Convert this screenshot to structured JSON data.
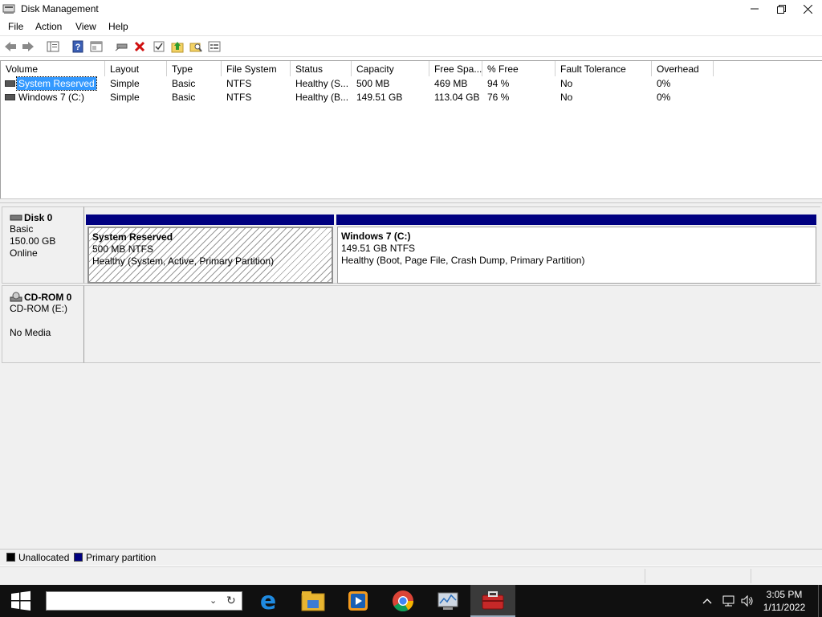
{
  "window": {
    "title": "Disk Management"
  },
  "menu": [
    "File",
    "Action",
    "View",
    "Help"
  ],
  "toolbar": {
    "icons": [
      "back-icon",
      "forward-icon",
      "console-tree-icon",
      "help-icon",
      "properties-icon",
      "connect-drive-icon",
      "delete-icon",
      "check-icon",
      "folder-up-icon",
      "folder-search-icon",
      "list-view-icon"
    ]
  },
  "volumes": {
    "columns": [
      "Volume",
      "Layout",
      "Type",
      "File System",
      "Status",
      "Capacity",
      "Free Spa...",
      "% Free",
      "Fault Tolerance",
      "Overhead"
    ],
    "rows": [
      {
        "volume": "System Reserved",
        "layout": "Simple",
        "type": "Basic",
        "fs": "NTFS",
        "status": "Healthy (S...",
        "capacity": "500 MB",
        "free": "469 MB",
        "pct": "94 %",
        "fault": "No",
        "overhead": "0%"
      },
      {
        "volume": "Windows 7 (C:)",
        "layout": "Simple",
        "type": "Basic",
        "fs": "NTFS",
        "status": "Healthy (B...",
        "capacity": "149.51 GB",
        "free": "113.04 GB",
        "pct": "76 %",
        "fault": "No",
        "overhead": "0%"
      }
    ]
  },
  "disks": [
    {
      "name": "Disk 0",
      "type": "Basic",
      "size": "150.00 GB",
      "state": "Online",
      "partitions": [
        {
          "name": "System Reserved",
          "size": "500 MB NTFS",
          "status": "Healthy (System, Active, Primary Partition)"
        },
        {
          "name": "Windows 7  (C:)",
          "size": "149.51 GB NTFS",
          "status": "Healthy (Boot, Page File, Crash Dump, Primary Partition)"
        }
      ]
    },
    {
      "name": "CD-ROM 0",
      "type": "CD-ROM (E:)",
      "state": "No Media"
    }
  ],
  "legend": {
    "unallocated": "Unallocated",
    "primary": "Primary partition"
  },
  "colors": {
    "primary_partition": "#000080",
    "unallocated": "#000000",
    "selection": "#3399ff"
  },
  "taskbar": {
    "search_placeholder": "",
    "apps": [
      "edge-icon",
      "file-explorer-icon",
      "media-player-icon",
      "chrome-icon",
      "performance-monitor-icon",
      "computer-management-icon"
    ],
    "time": "3:05 PM",
    "date": "1/11/2022"
  }
}
